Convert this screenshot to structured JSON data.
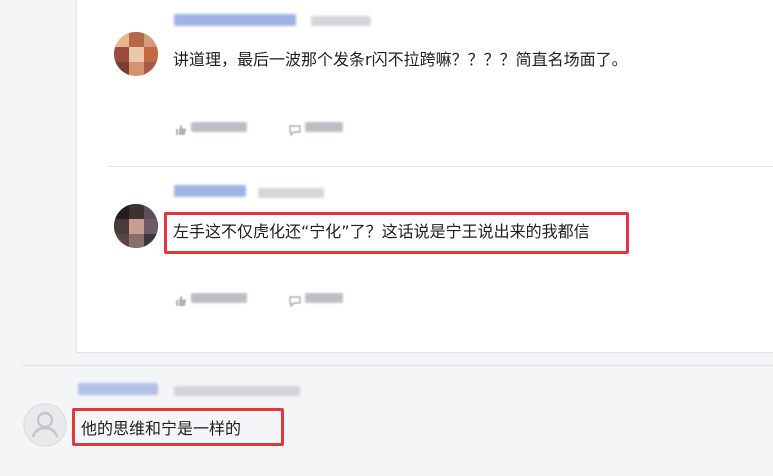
{
  "comments": [
    {
      "author": "",
      "time": "",
      "text": "讲道理，最后一波那个发条r闪不拉跨嘛？？？？简直名场面了。",
      "actions": {
        "like_icon": "thumbs-up-icon",
        "reply_icon": "reply-icon"
      }
    },
    {
      "author": "",
      "time": "",
      "text": "左手这不仅虎化还“宁化”了？这话说是宁王说出来的我都信",
      "highlighted": true,
      "actions": {
        "like_icon": "thumbs-up-icon",
        "reply_icon": "reply-icon"
      }
    },
    {
      "author": "",
      "time": "",
      "text": "他的思维和宁是一样的",
      "highlighted": true,
      "avatar": "default-user-avatar"
    }
  ],
  "colors": {
    "highlight_border": "#e0383e",
    "author_link": "#7b95d8",
    "page_bg": "#f4f5f7"
  }
}
